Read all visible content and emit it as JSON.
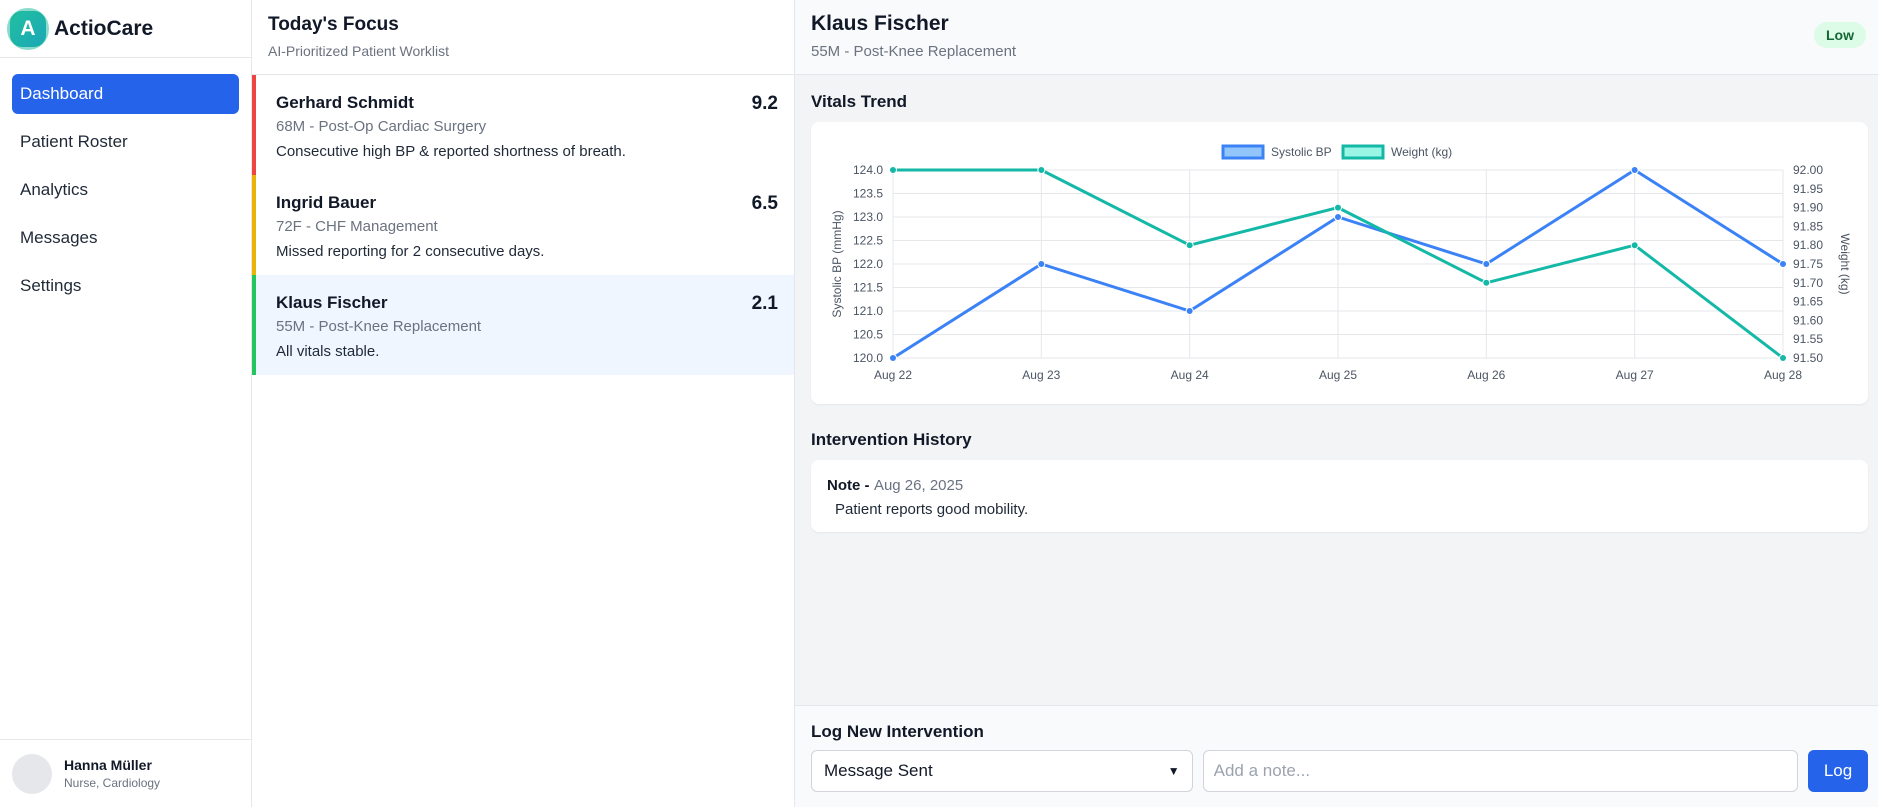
{
  "app": {
    "logo_letter": "A",
    "name": "ActioCare"
  },
  "sidebar": {
    "items": [
      {
        "label": "Dashboard",
        "active": true
      },
      {
        "label": "Patient Roster",
        "active": false
      },
      {
        "label": "Analytics",
        "active": false
      },
      {
        "label": "Messages",
        "active": false
      },
      {
        "label": "Settings",
        "active": false
      }
    ],
    "user": {
      "name": "Hanna Müller",
      "role": "Nurse, Cardiology"
    }
  },
  "worklist": {
    "title": "Today's Focus",
    "subtitle": "AI-Prioritized Patient Worklist",
    "patients": [
      {
        "name": "Gerhard Schmidt",
        "meta": "68M - Post-Op Cardiac Surgery",
        "note": "Consecutive high BP & reported shortness of breath.",
        "score": "9.2",
        "color": "#ef4444",
        "selected": false
      },
      {
        "name": "Ingrid Bauer",
        "meta": "72F - CHF Management",
        "note": "Missed reporting for 2 consecutive days.",
        "score": "6.5",
        "color": "#eab308",
        "selected": false
      },
      {
        "name": "Klaus Fischer",
        "meta": "55M - Post-Knee Replacement",
        "note": "All vitals stable.",
        "score": "2.1",
        "color": "#22c55e",
        "selected": true
      }
    ]
  },
  "detail": {
    "name": "Klaus Fischer",
    "meta": "55M - Post-Knee Replacement",
    "risk": "Low",
    "vitals_title": "Vitals Trend",
    "history_title": "Intervention History",
    "history": [
      {
        "type": "Note -",
        "date": "Aug 26, 2025",
        "text": "Patient reports good mobility."
      }
    ],
    "log": {
      "title": "Log New Intervention",
      "selected_type": "Message Sent",
      "placeholder": "Add a note...",
      "button": "Log"
    }
  },
  "chart_data": {
    "type": "line",
    "x": [
      "Aug 22",
      "Aug 23",
      "Aug 24",
      "Aug 25",
      "Aug 26",
      "Aug 27",
      "Aug 28"
    ],
    "series": [
      {
        "name": "Systolic BP",
        "axis": "left",
        "color": "#3b82f6",
        "values": [
          120,
          122,
          121,
          123,
          122,
          124,
          122
        ]
      },
      {
        "name": "Weight (kg)",
        "axis": "right",
        "color": "#14b8a6",
        "values": [
          92.0,
          92.0,
          91.8,
          91.9,
          91.7,
          91.8,
          91.5
        ]
      }
    ],
    "ylabel_left": "Systolic BP (mmHg)",
    "ylabel_right": "Weight (kg)",
    "ylim_left": [
      120,
      124
    ],
    "yticks_left": [
      "124.0",
      "123.5",
      "123.0",
      "122.5",
      "122.0",
      "121.5",
      "121.0",
      "120.5",
      "120.0"
    ],
    "ylim_right": [
      91.5,
      92.0
    ],
    "yticks_right": [
      "92.00",
      "91.95",
      "91.90",
      "91.85",
      "91.80",
      "91.75",
      "91.70",
      "91.65",
      "91.60",
      "91.55",
      "91.50"
    ],
    "grid": true,
    "legend": "top-center"
  }
}
